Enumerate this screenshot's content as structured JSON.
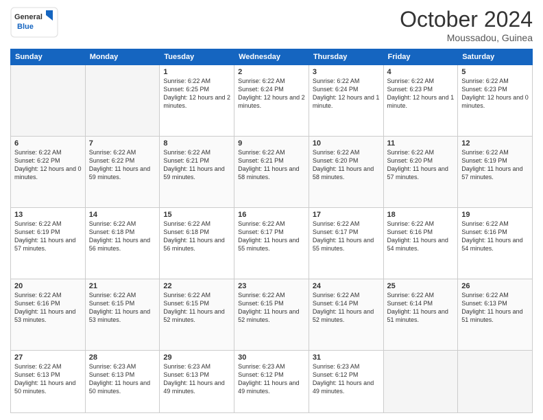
{
  "logo": {
    "line1": "General",
    "line2": "Blue"
  },
  "title": "October 2024",
  "location": "Moussadou, Guinea",
  "days_of_week": [
    "Sunday",
    "Monday",
    "Tuesday",
    "Wednesday",
    "Thursday",
    "Friday",
    "Saturday"
  ],
  "weeks": [
    [
      {
        "num": "",
        "empty": true
      },
      {
        "num": "",
        "empty": true
      },
      {
        "num": "1",
        "sunrise": "6:22 AM",
        "sunset": "6:25 PM",
        "daylight": "12 hours and 2 minutes."
      },
      {
        "num": "2",
        "sunrise": "6:22 AM",
        "sunset": "6:24 PM",
        "daylight": "12 hours and 2 minutes."
      },
      {
        "num": "3",
        "sunrise": "6:22 AM",
        "sunset": "6:24 PM",
        "daylight": "12 hours and 1 minute."
      },
      {
        "num": "4",
        "sunrise": "6:22 AM",
        "sunset": "6:23 PM",
        "daylight": "12 hours and 1 minute."
      },
      {
        "num": "5",
        "sunrise": "6:22 AM",
        "sunset": "6:23 PM",
        "daylight": "12 hours and 0 minutes."
      }
    ],
    [
      {
        "num": "6",
        "sunrise": "6:22 AM",
        "sunset": "6:22 PM",
        "daylight": "12 hours and 0 minutes."
      },
      {
        "num": "7",
        "sunrise": "6:22 AM",
        "sunset": "6:22 PM",
        "daylight": "11 hours and 59 minutes."
      },
      {
        "num": "8",
        "sunrise": "6:22 AM",
        "sunset": "6:21 PM",
        "daylight": "11 hours and 59 minutes."
      },
      {
        "num": "9",
        "sunrise": "6:22 AM",
        "sunset": "6:21 PM",
        "daylight": "11 hours and 58 minutes."
      },
      {
        "num": "10",
        "sunrise": "6:22 AM",
        "sunset": "6:20 PM",
        "daylight": "11 hours and 58 minutes."
      },
      {
        "num": "11",
        "sunrise": "6:22 AM",
        "sunset": "6:20 PM",
        "daylight": "11 hours and 57 minutes."
      },
      {
        "num": "12",
        "sunrise": "6:22 AM",
        "sunset": "6:19 PM",
        "daylight": "11 hours and 57 minutes."
      }
    ],
    [
      {
        "num": "13",
        "sunrise": "6:22 AM",
        "sunset": "6:19 PM",
        "daylight": "11 hours and 57 minutes."
      },
      {
        "num": "14",
        "sunrise": "6:22 AM",
        "sunset": "6:18 PM",
        "daylight": "11 hours and 56 minutes."
      },
      {
        "num": "15",
        "sunrise": "6:22 AM",
        "sunset": "6:18 PM",
        "daylight": "11 hours and 56 minutes."
      },
      {
        "num": "16",
        "sunrise": "6:22 AM",
        "sunset": "6:17 PM",
        "daylight": "11 hours and 55 minutes."
      },
      {
        "num": "17",
        "sunrise": "6:22 AM",
        "sunset": "6:17 PM",
        "daylight": "11 hours and 55 minutes."
      },
      {
        "num": "18",
        "sunrise": "6:22 AM",
        "sunset": "6:16 PM",
        "daylight": "11 hours and 54 minutes."
      },
      {
        "num": "19",
        "sunrise": "6:22 AM",
        "sunset": "6:16 PM",
        "daylight": "11 hours and 54 minutes."
      }
    ],
    [
      {
        "num": "20",
        "sunrise": "6:22 AM",
        "sunset": "6:16 PM",
        "daylight": "11 hours and 53 minutes."
      },
      {
        "num": "21",
        "sunrise": "6:22 AM",
        "sunset": "6:15 PM",
        "daylight": "11 hours and 53 minutes."
      },
      {
        "num": "22",
        "sunrise": "6:22 AM",
        "sunset": "6:15 PM",
        "daylight": "11 hours and 52 minutes."
      },
      {
        "num": "23",
        "sunrise": "6:22 AM",
        "sunset": "6:15 PM",
        "daylight": "11 hours and 52 minutes."
      },
      {
        "num": "24",
        "sunrise": "6:22 AM",
        "sunset": "6:14 PM",
        "daylight": "11 hours and 52 minutes."
      },
      {
        "num": "25",
        "sunrise": "6:22 AM",
        "sunset": "6:14 PM",
        "daylight": "11 hours and 51 minutes."
      },
      {
        "num": "26",
        "sunrise": "6:22 AM",
        "sunset": "6:13 PM",
        "daylight": "11 hours and 51 minutes."
      }
    ],
    [
      {
        "num": "27",
        "sunrise": "6:22 AM",
        "sunset": "6:13 PM",
        "daylight": "11 hours and 50 minutes."
      },
      {
        "num": "28",
        "sunrise": "6:23 AM",
        "sunset": "6:13 PM",
        "daylight": "11 hours and 50 minutes."
      },
      {
        "num": "29",
        "sunrise": "6:23 AM",
        "sunset": "6:13 PM",
        "daylight": "11 hours and 49 minutes."
      },
      {
        "num": "30",
        "sunrise": "6:23 AM",
        "sunset": "6:12 PM",
        "daylight": "11 hours and 49 minutes."
      },
      {
        "num": "31",
        "sunrise": "6:23 AM",
        "sunset": "6:12 PM",
        "daylight": "11 hours and 49 minutes."
      },
      {
        "num": "",
        "empty": true
      },
      {
        "num": "",
        "empty": true
      }
    ]
  ],
  "labels": {
    "sunrise": "Sunrise:",
    "sunset": "Sunset:",
    "daylight": "Daylight:"
  }
}
